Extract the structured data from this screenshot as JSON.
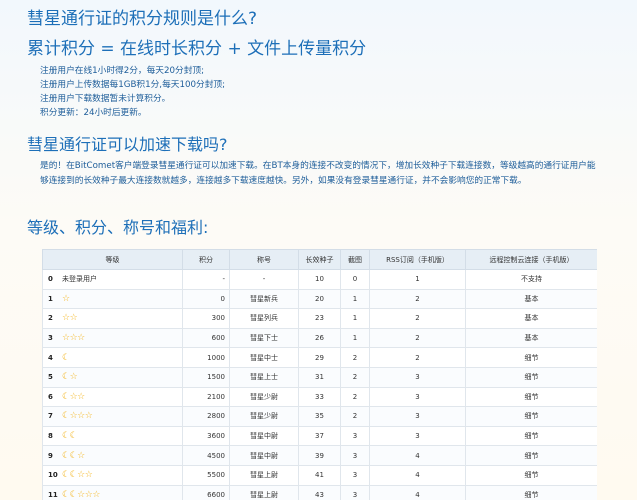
{
  "headings": {
    "rules_title": "彗星通行证的积分规则是什么?",
    "formula": "累计积分 = 在线时长积分 + 文件上传量积分",
    "speed_title": "彗星通行证可以加速下载吗?",
    "levels_title": "等级、积分、称号和福利:"
  },
  "rules": [
    "注册用户在线1小时得2分，每天20分封顶;",
    "注册用户上传数据每1GB积1分,每天100分封顶;",
    "注册用户下载数据暂未计算积分。",
    "积分更新：24小时后更新。"
  ],
  "speed_text": "是的！在BitComet客户端登录彗星通行证可以加速下载。在BT本身的连接不改变的情况下，增加长效种子下载连接数，等级越高的通行证用户能够连接到的长效种子最大连接数就越多，连接越多下载速度越快。另外，如果没有登录彗星通行证，并不会影响您的正常下载。",
  "table": {
    "headers": [
      "等级",
      "积分",
      "称号",
      "长效种子",
      "截图",
      "RSS订阅（手机版）",
      "远程控制云连接（手机版）"
    ],
    "rows": [
      {
        "level": "0",
        "label": "未登录用户",
        "stars": 0,
        "moons": 0,
        "points": "-",
        "title": "-",
        "seeds": "10",
        "shots": "0",
        "rss": "1",
        "remote": "不支持"
      },
      {
        "level": "1",
        "label": "",
        "stars": 1,
        "moons": 0,
        "points": "0",
        "title": "彗星新兵",
        "seeds": "20",
        "shots": "1",
        "rss": "2",
        "remote": "基本"
      },
      {
        "level": "2",
        "label": "",
        "stars": 2,
        "moons": 0,
        "points": "300",
        "title": "彗星列兵",
        "seeds": "23",
        "shots": "1",
        "rss": "2",
        "remote": "基本"
      },
      {
        "level": "3",
        "label": "",
        "stars": 3,
        "moons": 0,
        "points": "600",
        "title": "彗星下士",
        "seeds": "26",
        "shots": "1",
        "rss": "2",
        "remote": "基本"
      },
      {
        "level": "4",
        "label": "",
        "stars": 0,
        "moons": 1,
        "points": "1000",
        "title": "彗星中士",
        "seeds": "29",
        "shots": "2",
        "rss": "2",
        "remote": "细节"
      },
      {
        "level": "5",
        "label": "",
        "stars": 1,
        "moons": 1,
        "points": "1500",
        "title": "彗星上士",
        "seeds": "31",
        "shots": "2",
        "rss": "3",
        "remote": "细节"
      },
      {
        "level": "6",
        "label": "",
        "stars": 2,
        "moons": 1,
        "points": "2100",
        "title": "彗星少尉",
        "seeds": "33",
        "shots": "2",
        "rss": "3",
        "remote": "细节"
      },
      {
        "level": "7",
        "label": "",
        "stars": 3,
        "moons": 1,
        "points": "2800",
        "title": "彗星少尉",
        "seeds": "35",
        "shots": "2",
        "rss": "3",
        "remote": "细节"
      },
      {
        "level": "8",
        "label": "",
        "stars": 0,
        "moons": 2,
        "points": "3600",
        "title": "彗星中尉",
        "seeds": "37",
        "shots": "3",
        "rss": "3",
        "remote": "细节"
      },
      {
        "level": "9",
        "label": "",
        "stars": 1,
        "moons": 2,
        "points": "4500",
        "title": "彗星中尉",
        "seeds": "39",
        "shots": "3",
        "rss": "4",
        "remote": "细节"
      },
      {
        "level": "10",
        "label": "",
        "stars": 2,
        "moons": 2,
        "points": "5500",
        "title": "彗星上尉",
        "seeds": "41",
        "shots": "3",
        "rss": "4",
        "remote": "细节"
      },
      {
        "level": "11",
        "label": "",
        "stars": 3,
        "moons": 2,
        "points": "6600",
        "title": "彗星上尉",
        "seeds": "43",
        "shots": "3",
        "rss": "4",
        "remote": "细节"
      }
    ]
  },
  "icons": {
    "star": "star-icon",
    "moon": "moon-icon"
  },
  "colors": {
    "heading": "#1d6fb8",
    "text": "#1f5e9a",
    "badge": "#f3b51f",
    "table_header_bg": "#e6eef5"
  }
}
